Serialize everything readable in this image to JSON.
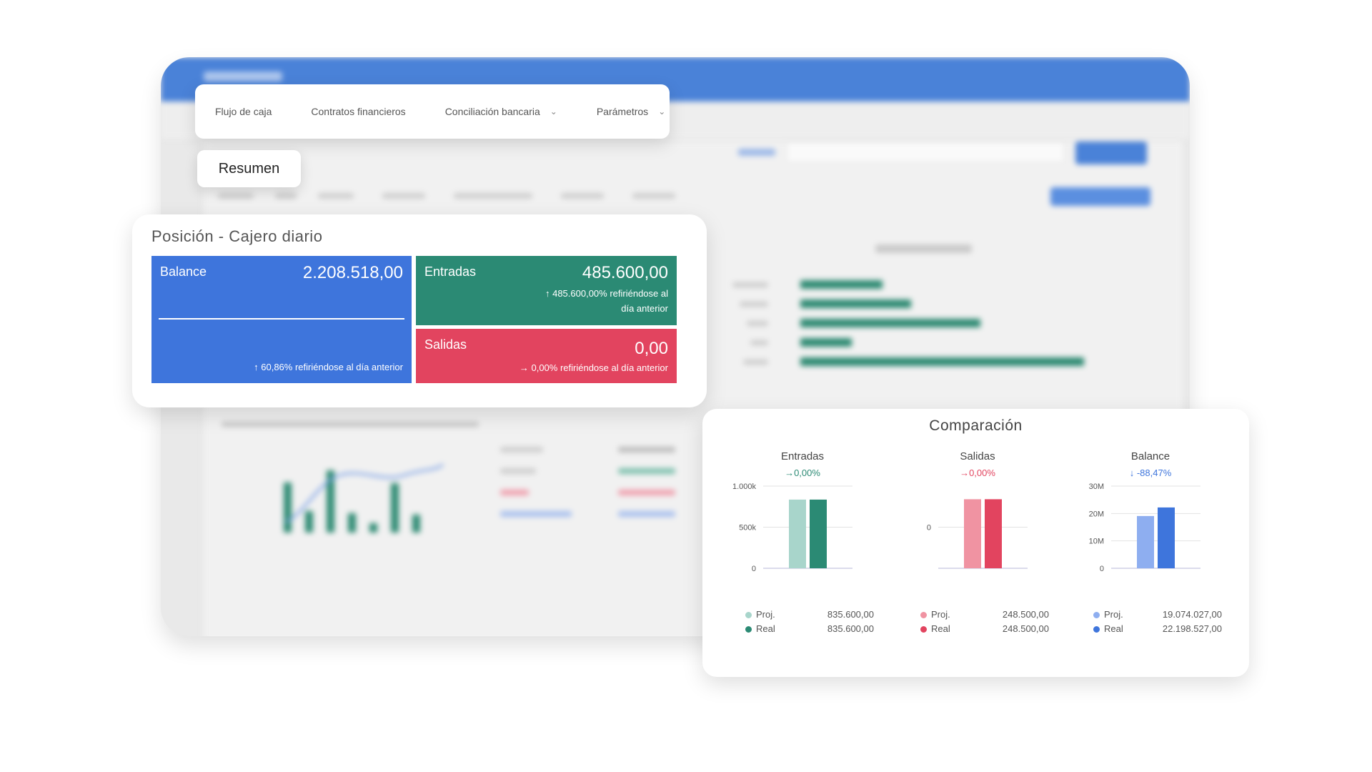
{
  "nav": {
    "items": [
      {
        "label": "Flujo de caja",
        "dropdown": false
      },
      {
        "label": "Contratos financieros",
        "dropdown": false
      },
      {
        "label": "Conciliación bancaria",
        "dropdown": true
      },
      {
        "label": "Parámetros",
        "dropdown": true
      }
    ],
    "chevron": "⌄"
  },
  "resumen_label": "Resumen",
  "position": {
    "title": "Posición - Cajero diario",
    "balance": {
      "label": "Balance",
      "value": "2.208.518,00",
      "note": "↑ 60,86% refiriéndose al día anterior",
      "color": "#3e75dc"
    },
    "entradas": {
      "label": "Entradas",
      "value": "485.600,00",
      "note_line1": "↑ 485.600,00% refiriéndose al",
      "note_line2": "día anterior",
      "color": "#2b8a74"
    },
    "salidas": {
      "label": "Salidas",
      "value": "0,00",
      "note": "→ 0,00% refiriéndose al día anterior",
      "color": "#e2445f"
    }
  },
  "comparison": {
    "title": "Comparación",
    "panels": [
      {
        "name": "Entradas",
        "delta": "→0,00%",
        "delta_color": "#2b8a74",
        "ticks": [
          "1.000k",
          "500k",
          "0"
        ],
        "colors": {
          "proj": "#a8d5cb",
          "real": "#2b8a74"
        },
        "legend": [
          {
            "label": "Proj.",
            "value": "835.600,00"
          },
          {
            "label": "Real",
            "value": "835.600,00"
          }
        ]
      },
      {
        "name": "Salidas",
        "delta": "→0,00%",
        "delta_color": "#e2445f",
        "ticks": [
          "0"
        ],
        "colors": {
          "proj": "#f093a2",
          "real": "#e2445f"
        },
        "legend": [
          {
            "label": "Proj.",
            "value": "248.500,00"
          },
          {
            "label": "Real",
            "value": "248.500,00"
          }
        ]
      },
      {
        "name": "Balance",
        "delta": "↓ -88,47%",
        "delta_color": "#3e75dc",
        "ticks": [
          "30M",
          "20M",
          "10M",
          "0"
        ],
        "colors": {
          "proj": "#8eaef0",
          "real": "#3e75dc"
        },
        "legend": [
          {
            "label": "Proj.",
            "value": "19.074.027,00"
          },
          {
            "label": "Real",
            "value": "22.198.527,00"
          }
        ]
      }
    ]
  },
  "chart_data": [
    {
      "type": "bar",
      "title": "Entradas",
      "categories": [
        "Proj.",
        "Real"
      ],
      "values": [
        835600,
        835600
      ],
      "ylim": [
        0,
        1000000
      ],
      "yticks": [
        "1.000k",
        "500k",
        "0"
      ]
    },
    {
      "type": "bar",
      "title": "Salidas",
      "categories": [
        "Proj.",
        "Real"
      ],
      "values": [
        248500,
        248500
      ],
      "yticks": [
        "0"
      ]
    },
    {
      "type": "bar",
      "title": "Balance",
      "categories": [
        "Proj.",
        "Real"
      ],
      "values": [
        19074027,
        22198527
      ],
      "ylim": [
        0,
        30000000
      ],
      "yticks": [
        "30M",
        "20M",
        "10M",
        "0"
      ]
    }
  ]
}
